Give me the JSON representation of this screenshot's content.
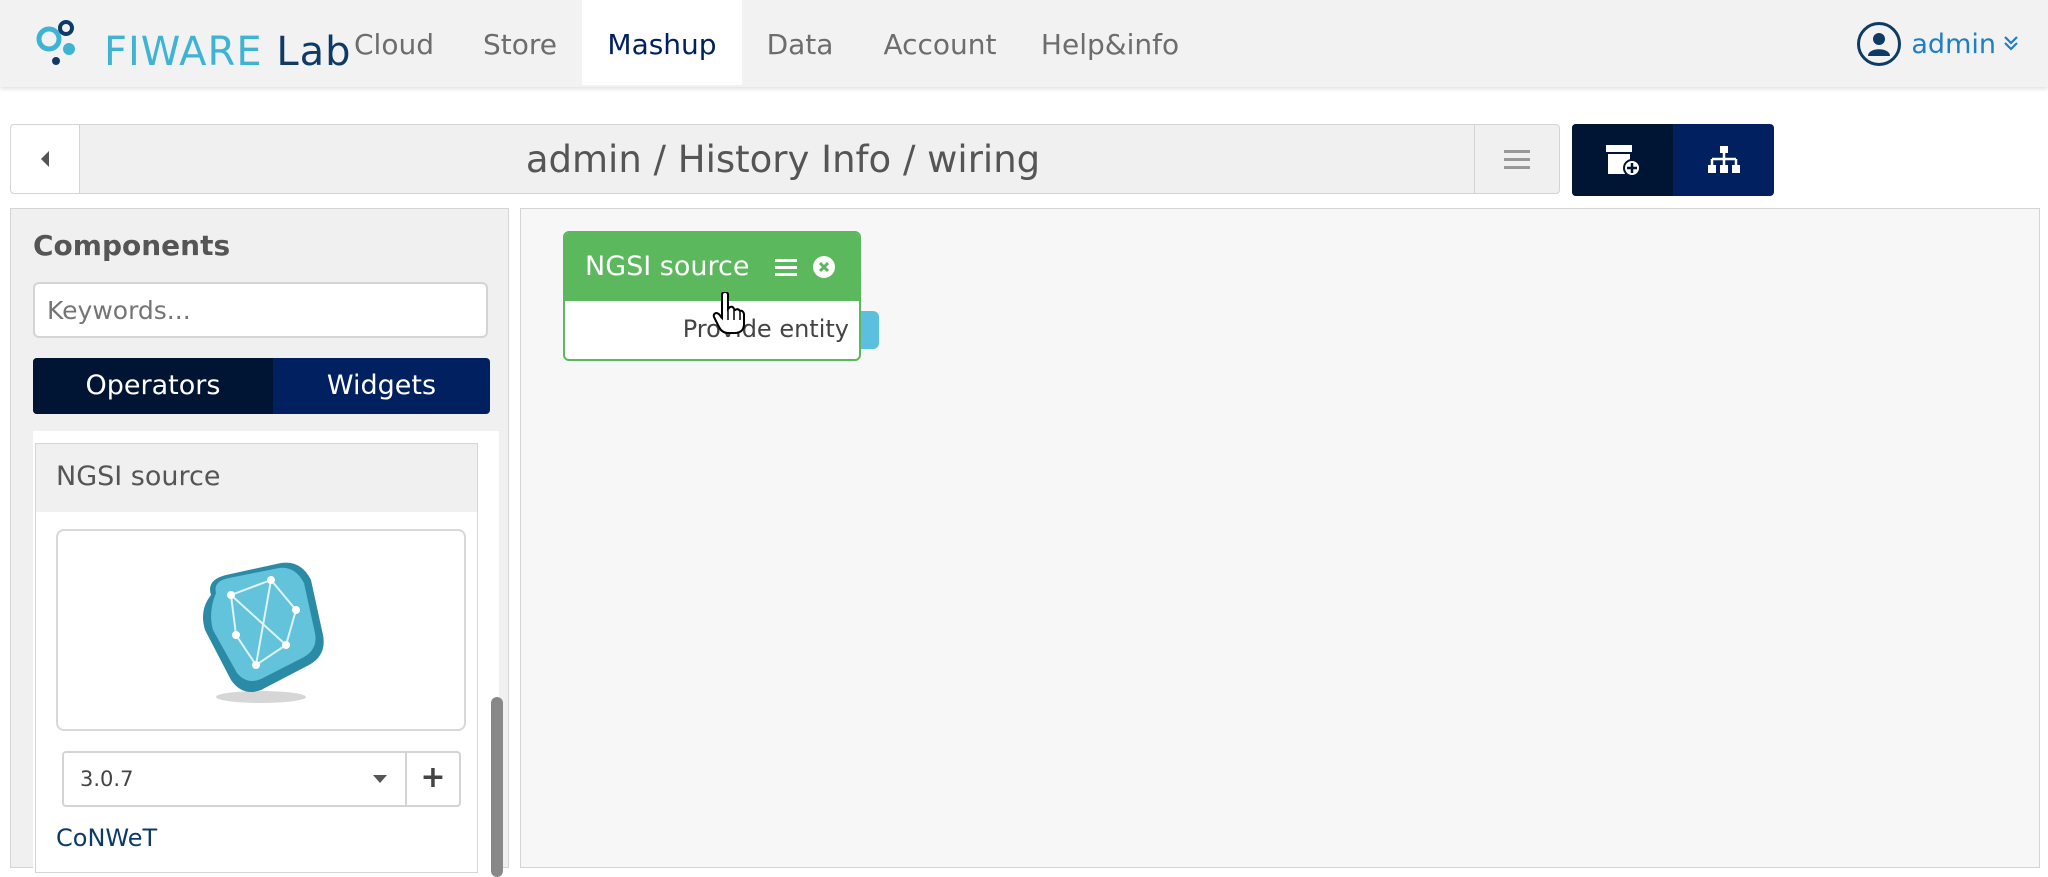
{
  "brand": {
    "name": "FIWARE",
    "suffix": "Lab"
  },
  "nav": [
    {
      "label": "Cloud",
      "active": false
    },
    {
      "label": "Store",
      "active": false
    },
    {
      "label": "Mashup",
      "active": true
    },
    {
      "label": "Data",
      "active": false
    },
    {
      "label": "Account",
      "active": false
    },
    {
      "label": "Help&info",
      "active": false
    }
  ],
  "user": {
    "name": "admin",
    "icon": "user-icon"
  },
  "header": {
    "breadcrumb": "admin / History Info / wiring"
  },
  "toolbar": {
    "icons": [
      "add-component-icon",
      "sitemap-icon"
    ]
  },
  "sidebar": {
    "title": "Components",
    "search_placeholder": "Keywords...",
    "tabs": [
      {
        "label": "Operators",
        "active": true
      },
      {
        "label": "Widgets",
        "active": false
      }
    ],
    "components": [
      {
        "name": "NGSI source",
        "version": "3.0.7",
        "vendor": "CoNWeT"
      }
    ]
  },
  "canvas": {
    "operators": [
      {
        "title": "NGSI source",
        "outputs": [
          "Provide entity"
        ]
      }
    ]
  },
  "colors": {
    "brand_blue": "#3fb3d3",
    "navy": "#002060",
    "operator_green": "#5cb85c",
    "endpoint": "#5bc0de"
  }
}
